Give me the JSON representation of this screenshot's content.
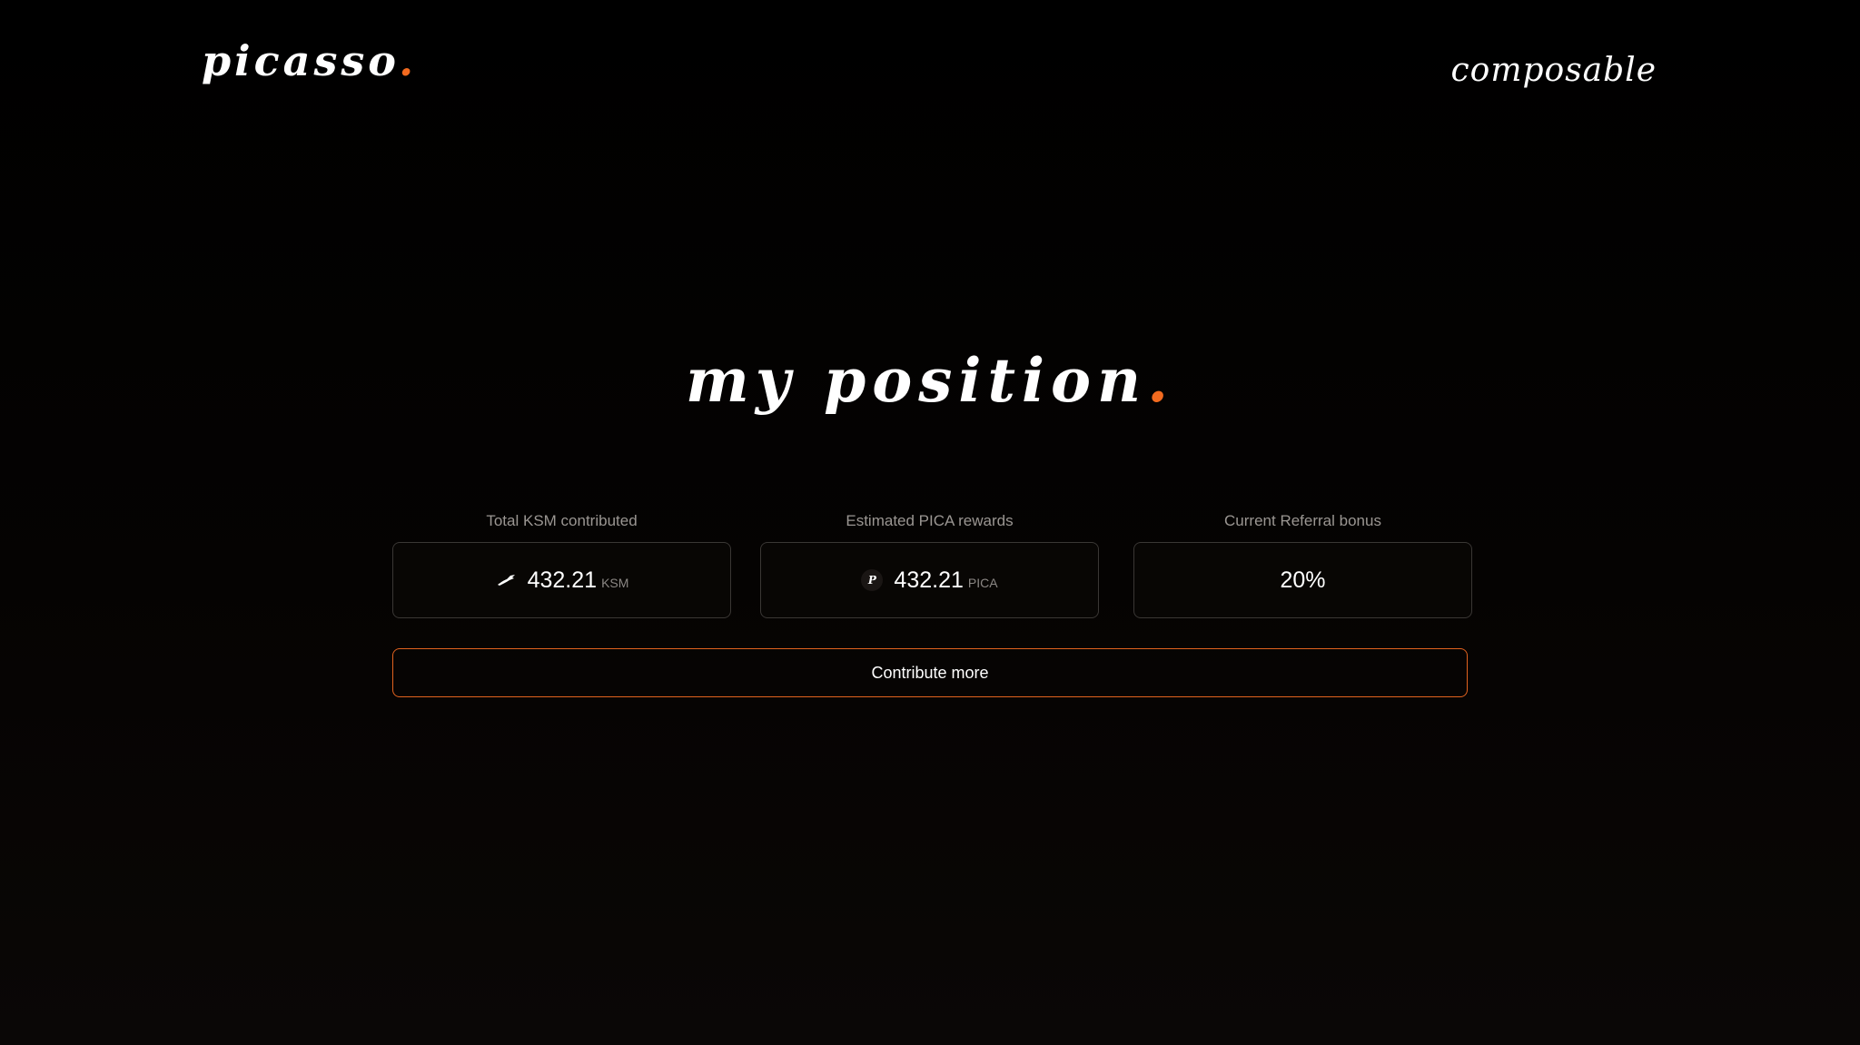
{
  "header": {
    "brand": "picasso",
    "brand_dot": ".",
    "partner": "composable"
  },
  "title": {
    "text": "my position",
    "dot": "."
  },
  "stats": [
    {
      "label": "Total KSM contributed",
      "value": "432.21",
      "unit": "KSM",
      "icon": "kusama-bird-icon"
    },
    {
      "label": "Estimated PICA rewards",
      "value": "432.21",
      "unit": "PICA",
      "icon": "pica-token-icon",
      "icon_letter": "P"
    },
    {
      "label": "Current Referral bonus",
      "value": "20%"
    }
  ],
  "actions": {
    "contribute_label": "Contribute more"
  },
  "colors": {
    "accent": "#f26a1f",
    "background": "#000000",
    "card_border": "#3a3734",
    "muted_text": "#9a9692"
  }
}
